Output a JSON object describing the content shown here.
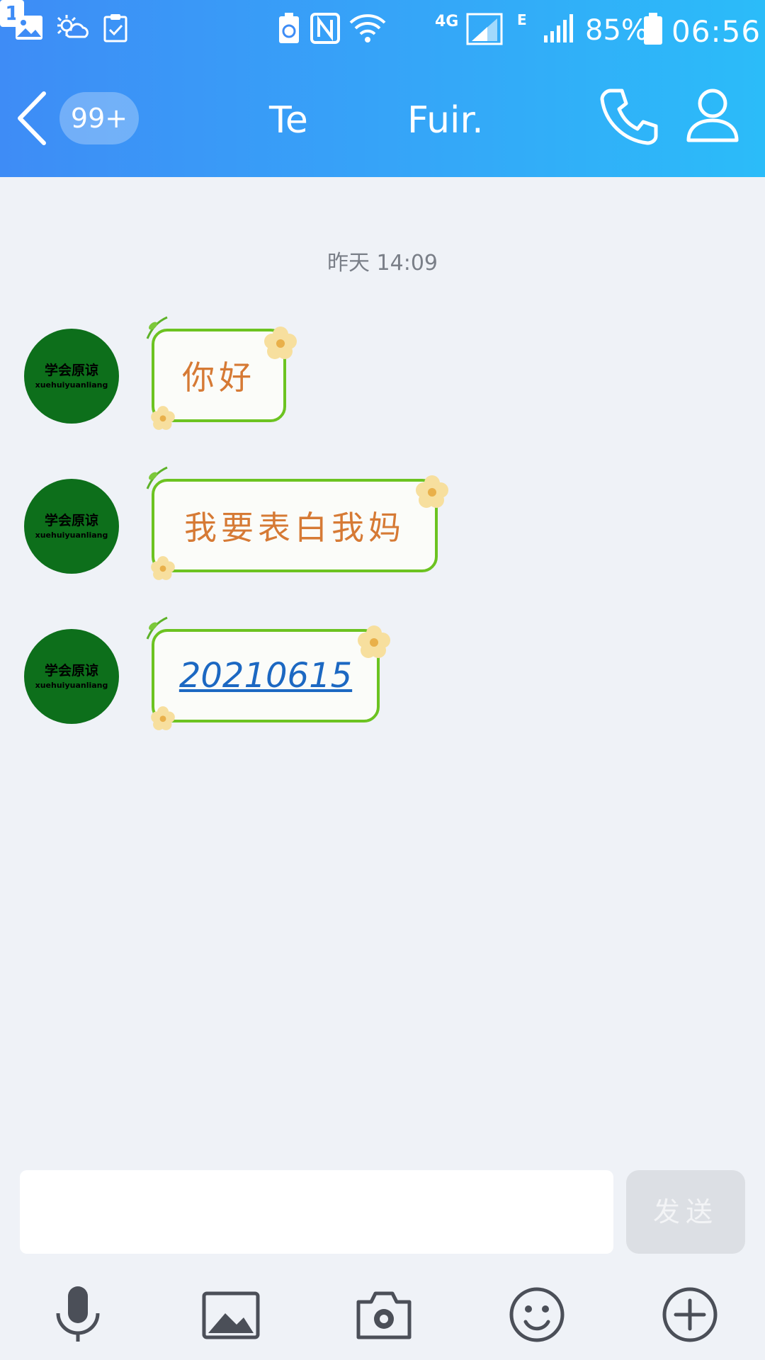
{
  "status_bar": {
    "network_type": "4G",
    "network_secondary": "E",
    "sim_slot": "1",
    "battery_percent": "85%",
    "time": "06:56"
  },
  "header": {
    "unread_badge": "99+",
    "title_part1": "Te",
    "title_part2": "Fuir.",
    "accent_color": "#3e8cf6"
  },
  "chat": {
    "timestamp": "昨天 14:09",
    "avatar": {
      "name_cn": "学会原谅",
      "name_pinyin": "xuehuiyuanliang"
    },
    "messages": [
      {
        "text": "你好",
        "type": "text"
      },
      {
        "text": "我要表白我妈",
        "type": "text"
      },
      {
        "text": "20210615",
        "type": "link"
      }
    ]
  },
  "input_bar": {
    "placeholder": "",
    "send_label": "发送"
  },
  "toolbar": {
    "items": [
      "microphone-icon",
      "image-icon",
      "camera-icon",
      "emoji-icon",
      "plus-icon"
    ]
  }
}
